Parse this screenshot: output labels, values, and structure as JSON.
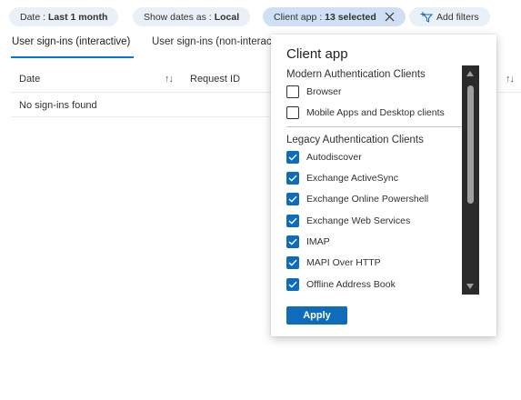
{
  "filters": {
    "date": {
      "label": "Date :",
      "value": "Last 1 month"
    },
    "show_dates": {
      "label": "Show dates as :",
      "value": "Local"
    },
    "client_app": {
      "label": "Client app :",
      "value": "13 selected"
    },
    "add_filters": {
      "label": "Add filters"
    }
  },
  "tabs": {
    "interactive": "User sign-ins (interactive)",
    "non_interactive": "User sign-ins (non-interac"
  },
  "table": {
    "columns": {
      "date": "Date",
      "request_id": "Request ID"
    },
    "empty_message": "No sign-ins found"
  },
  "panel": {
    "title": "Client app",
    "modern_heading": "Modern Authentication Clients",
    "modern_options": [
      {
        "label": "Browser",
        "checked": false
      },
      {
        "label": "Mobile Apps and Desktop clients",
        "checked": false
      }
    ],
    "legacy_heading": "Legacy Authentication Clients",
    "legacy_options": [
      {
        "label": "Autodiscover",
        "checked": true
      },
      {
        "label": "Exchange ActiveSync",
        "checked": true
      },
      {
        "label": "Exchange Online Powershell",
        "checked": true
      },
      {
        "label": "Exchange Web Services",
        "checked": true
      },
      {
        "label": "IMAP",
        "checked": true
      },
      {
        "label": "MAPI Over HTTP",
        "checked": true
      },
      {
        "label": "Offline Address Book",
        "checked": true
      }
    ],
    "apply_label": "Apply"
  },
  "colors": {
    "accent": "#0f6cbd",
    "pill": "#eaf0f8",
    "pill_active": "#cfe0f5"
  }
}
